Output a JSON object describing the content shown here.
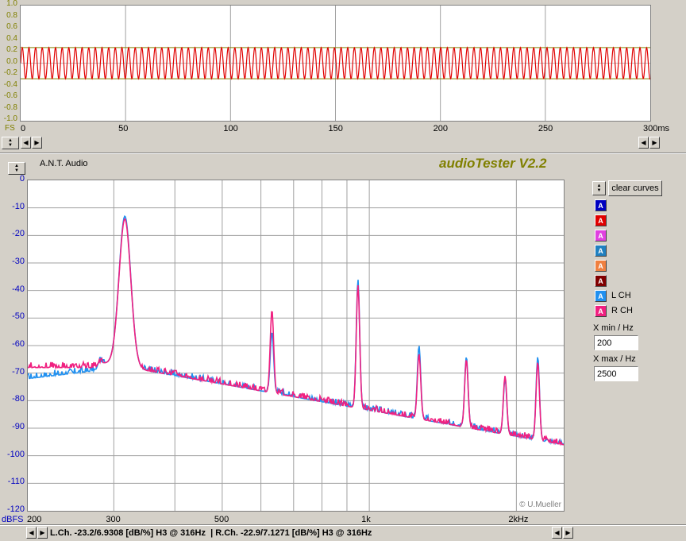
{
  "time_plot": {
    "y_ticks": [
      "1.0",
      "0.8",
      "0.6",
      "0.4",
      "0.2",
      "0.0",
      "-0.2",
      "-0.4",
      "-0.6",
      "-0.8",
      "-1.0"
    ],
    "y_unit": "FS",
    "x_ticks": [
      "0",
      "50",
      "100",
      "150",
      "200",
      "250",
      "300ms"
    ],
    "wave_color": "#e00000",
    "envelope_color": "#808000"
  },
  "header": {
    "device_label": "A.N.T. Audio",
    "app_title": "audioTester V2.2",
    "title_color": "#808000"
  },
  "spectrum": {
    "y_ticks": [
      "0",
      "-10",
      "-20",
      "-30",
      "-40",
      "-50",
      "-60",
      "-70",
      "-80",
      "-90",
      "-100",
      "-110",
      "-120"
    ],
    "y_unit": "dBFS",
    "x_ticks": [
      "200",
      "300",
      "500",
      "1k",
      "2kHz"
    ],
    "watermark": "© U.Mueller"
  },
  "side_panel": {
    "clear_label": "clear curves",
    "legend": [
      {
        "letter": "A",
        "color": "#0000c0",
        "label": ""
      },
      {
        "letter": "A",
        "color": "#e00000",
        "label": ""
      },
      {
        "letter": "A",
        "color": "#e040e0",
        "label": ""
      },
      {
        "letter": "A",
        "color": "#2080c0",
        "label": ""
      },
      {
        "letter": "A",
        "color": "#f08040",
        "label": ""
      },
      {
        "letter": "A",
        "color": "#800000",
        "label": ""
      },
      {
        "letter": "A",
        "color": "#2090f0",
        "label": "L CH"
      },
      {
        "letter": "A",
        "color": "#f02080",
        "label": "R CH"
      }
    ],
    "xmin_label": "X min / Hz",
    "xmin_value": "200",
    "xmax_label": "X max / Hz",
    "xmax_value": "2500"
  },
  "status": {
    "text": "L.Ch. -23.2/6.9308 [dB/%] H3 @ 316Hz  | R.Ch. -22.9/7.1271 [dB/%] H3 @ 316Hz"
  },
  "chart_data": [
    {
      "type": "line",
      "title": "",
      "xlabel": "ms",
      "ylabel": "FS",
      "xlim": [
        0,
        300
      ],
      "ylim": [
        -1.0,
        1.0
      ],
      "series": [
        {
          "values": [
            0.27,
            -0.27
          ],
          "frequency_hz": 316
        }
      ]
    },
    {
      "type": "line",
      "title": "",
      "xlabel": "Hz",
      "ylabel": "dBFS",
      "x_scale": "log",
      "xlim": [
        200,
        2500
      ],
      "ylim": [
        -120,
        0
      ],
      "series": [
        {
          "name": "L CH",
          "x": [
            200,
            250,
            280,
            300,
            316,
            330,
            400,
            500,
            600,
            632,
            700,
            800,
            900,
            948,
            1000,
            1264,
            1580,
            1896,
            2212,
            2500
          ],
          "values": [
            -72,
            -70,
            -66,
            -62,
            -13,
            -62,
            -72,
            -78,
            -84,
            -55,
            -86,
            -88,
            -90,
            -36,
            -90,
            -60,
            -64,
            -72,
            -64,
            -98
          ]
        },
        {
          "name": "R CH",
          "x": [
            200,
            250,
            280,
            300,
            316,
            330,
            400,
            500,
            600,
            632,
            700,
            800,
            900,
            948,
            1000,
            1264,
            1580,
            1896,
            2212,
            2500
          ],
          "values": [
            -68,
            -68,
            -66,
            -61,
            -14,
            -61,
            -69,
            -74,
            -80,
            -47,
            -84,
            -86,
            -88,
            -38,
            -88,
            -63,
            -65,
            -71,
            -66,
            -97
          ]
        }
      ]
    }
  ]
}
